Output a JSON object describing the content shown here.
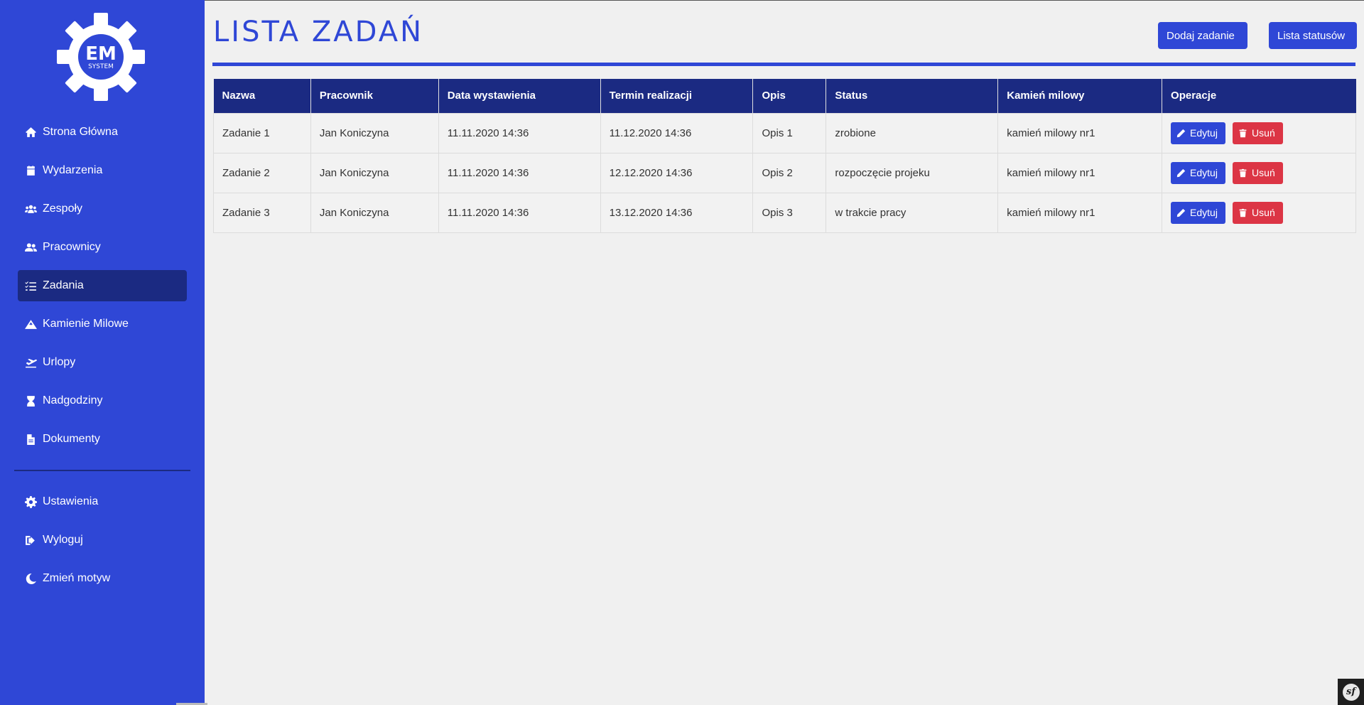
{
  "logo": {
    "main": "EM",
    "sub": "SYSTEM"
  },
  "sidebar": {
    "items": [
      {
        "label": "Strona Główna",
        "icon": "home-icon"
      },
      {
        "label": "Wydarzenia",
        "icon": "calendar-icon"
      },
      {
        "label": "Zespoły",
        "icon": "users-group-icon"
      },
      {
        "label": "Pracownicy",
        "icon": "user-friends-icon"
      },
      {
        "label": "Zadania",
        "icon": "tasks-icon",
        "active": true
      },
      {
        "label": "Kamienie Milowe",
        "icon": "mountain-icon"
      },
      {
        "label": "Urlopy",
        "icon": "plane-departure-icon"
      },
      {
        "label": "Nadgodziny",
        "icon": "hourglass-icon"
      },
      {
        "label": "Dokumenty",
        "icon": "file-icon"
      }
    ],
    "bottom_items": [
      {
        "label": "Ustawienia",
        "icon": "gear-icon"
      },
      {
        "label": "Wyloguj",
        "icon": "sign-out-icon"
      },
      {
        "label": "Zmień motyw",
        "icon": "moon-icon"
      }
    ]
  },
  "header": {
    "title": "LISTA ZADAŃ",
    "add_button": "Dodaj zadanie",
    "statuses_button": "Lista statusów"
  },
  "table": {
    "columns": [
      "Nazwa",
      "Pracownik",
      "Data wystawienia",
      "Termin realizacji",
      "Opis",
      "Status",
      "Kamień milowy",
      "Operacje"
    ],
    "rows": [
      [
        "Zadanie 1",
        "Jan Koniczyna",
        "11.11.2020 14:36",
        "11.12.2020 14:36",
        "Opis 1",
        "zrobione",
        "kamień milowy nr1"
      ],
      [
        "Zadanie 2",
        "Jan Koniczyna",
        "11.11.2020 14:36",
        "12.12.2020 14:36",
        "Opis 2",
        "rozpoczęcie projeku",
        "kamień milowy nr1"
      ],
      [
        "Zadanie 3",
        "Jan Koniczyna",
        "11.11.2020 14:36",
        "13.12.2020 14:36",
        "Opis 3",
        "w trakcie pracy",
        "kamień milowy nr1"
      ]
    ],
    "edit_label": "Edytuj",
    "delete_label": "Usuń"
  },
  "colors": {
    "sidebar_bg": "#2f47d6",
    "active_item": "#1b2a82",
    "header_row": "#1b2a82",
    "delete": "#dc3545"
  }
}
